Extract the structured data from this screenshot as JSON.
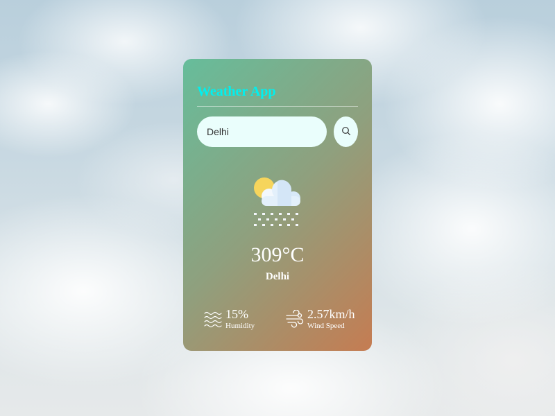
{
  "app": {
    "title": "Weather App"
  },
  "search": {
    "value": "Delhi",
    "button_icon": "search-icon"
  },
  "weather": {
    "icon": "sun-cloud-snow-icon",
    "temperature": "309°C",
    "city": "Delhi"
  },
  "details": {
    "humidity": {
      "icon": "humidity-waves-icon",
      "value": "15%",
      "label": "Humidity"
    },
    "wind": {
      "icon": "wind-icon",
      "value": "2.57km/h",
      "label": "Wind Speed"
    }
  },
  "colors": {
    "title": "#00f0f0",
    "card_gradient_start": "#66bd9b",
    "card_gradient_end": "#c57c52",
    "input_bg": "#eafefc",
    "sun": "#f6d55c",
    "cloud": "#e3f0fb"
  }
}
